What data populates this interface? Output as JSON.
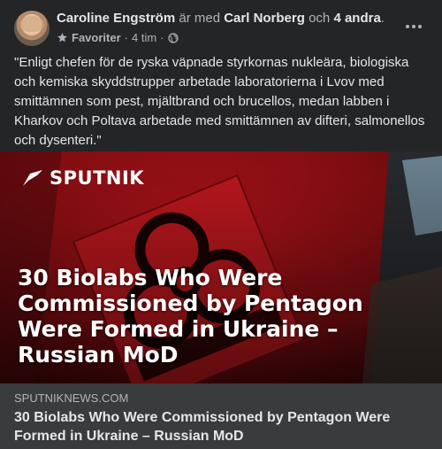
{
  "post": {
    "author": "Caroline Engström",
    "with_text": "är med",
    "tagged": "Carl Norberg",
    "and_text": "och",
    "others": "4 andra",
    "period": ".",
    "favorite_label": "Favoriter",
    "separator": "·",
    "time": "4 tim",
    "separator2": "·",
    "body": "\"Enligt chefen för de ryska väpnade styrkornas nukleära, biologiska och kemiska skyddstrupper arbetade laboratorierna i Lvov med smittämnen som pest, mjältbrand och brucellos, medan labben i Kharkov och Poltava arbetade med smittämnen av difteri, salmonellos och dysenteri.\""
  },
  "media": {
    "logo_text": "SPUTNIK",
    "headline": "30 Biolabs Who Were Commissioned by Pentagon Were Formed in Ukraine – Russian MoD"
  },
  "link": {
    "domain": "SPUTNIKNEWS.COM",
    "title": "30 Biolabs Who Were Commissioned by Pentagon Were Formed in Ukraine – Russian MoD"
  },
  "colors": {
    "background": "#242526",
    "link_box": "#3a3b3c",
    "text_primary": "#e4e6eb",
    "text_secondary": "#b0b3b8",
    "media_red": "#b31218"
  },
  "icons": [
    "star-icon",
    "globe-icon",
    "more-options-icon",
    "sputnik-logo-icon",
    "biohazard-symbol"
  ]
}
